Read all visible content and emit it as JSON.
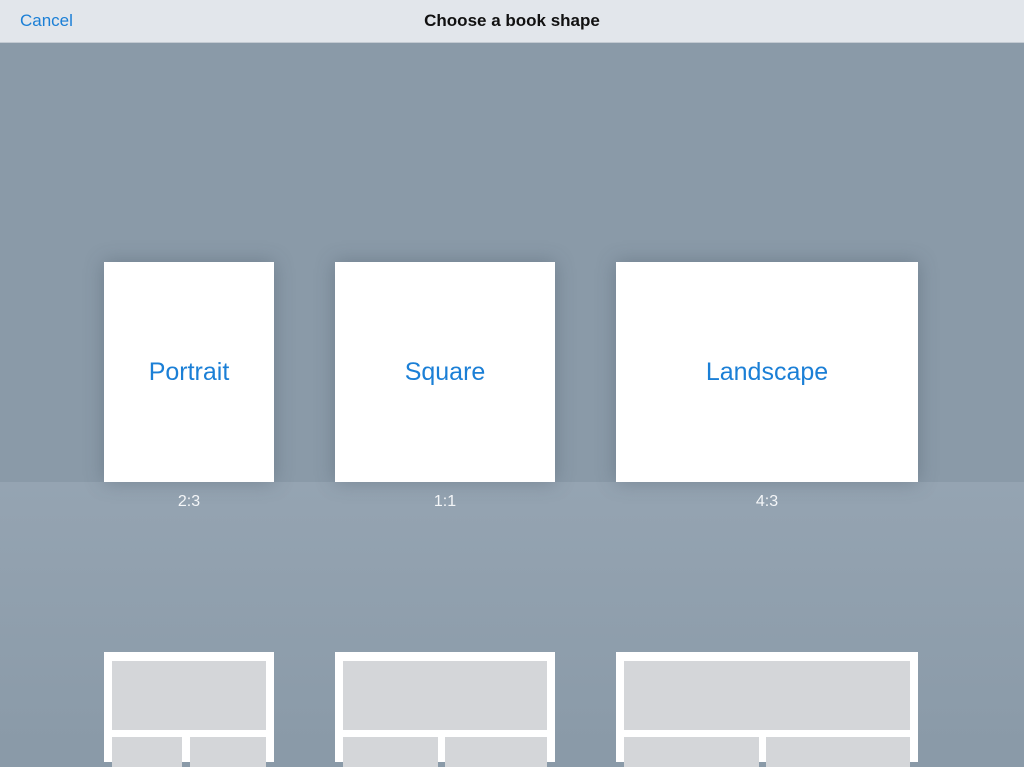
{
  "navbar": {
    "cancel_label": "Cancel",
    "title": "Choose a book shape"
  },
  "shapes": [
    {
      "label": "Portrait",
      "ratio": "2:3"
    },
    {
      "label": "Square",
      "ratio": "1:1"
    },
    {
      "label": "Landscape",
      "ratio": "4:3"
    }
  ],
  "colors": {
    "accent": "#1b7fd6",
    "background": "#8a9aa8",
    "navbar": "#e2e6eb",
    "card": "#ffffff",
    "placeholder": "#d4d6d9"
  }
}
